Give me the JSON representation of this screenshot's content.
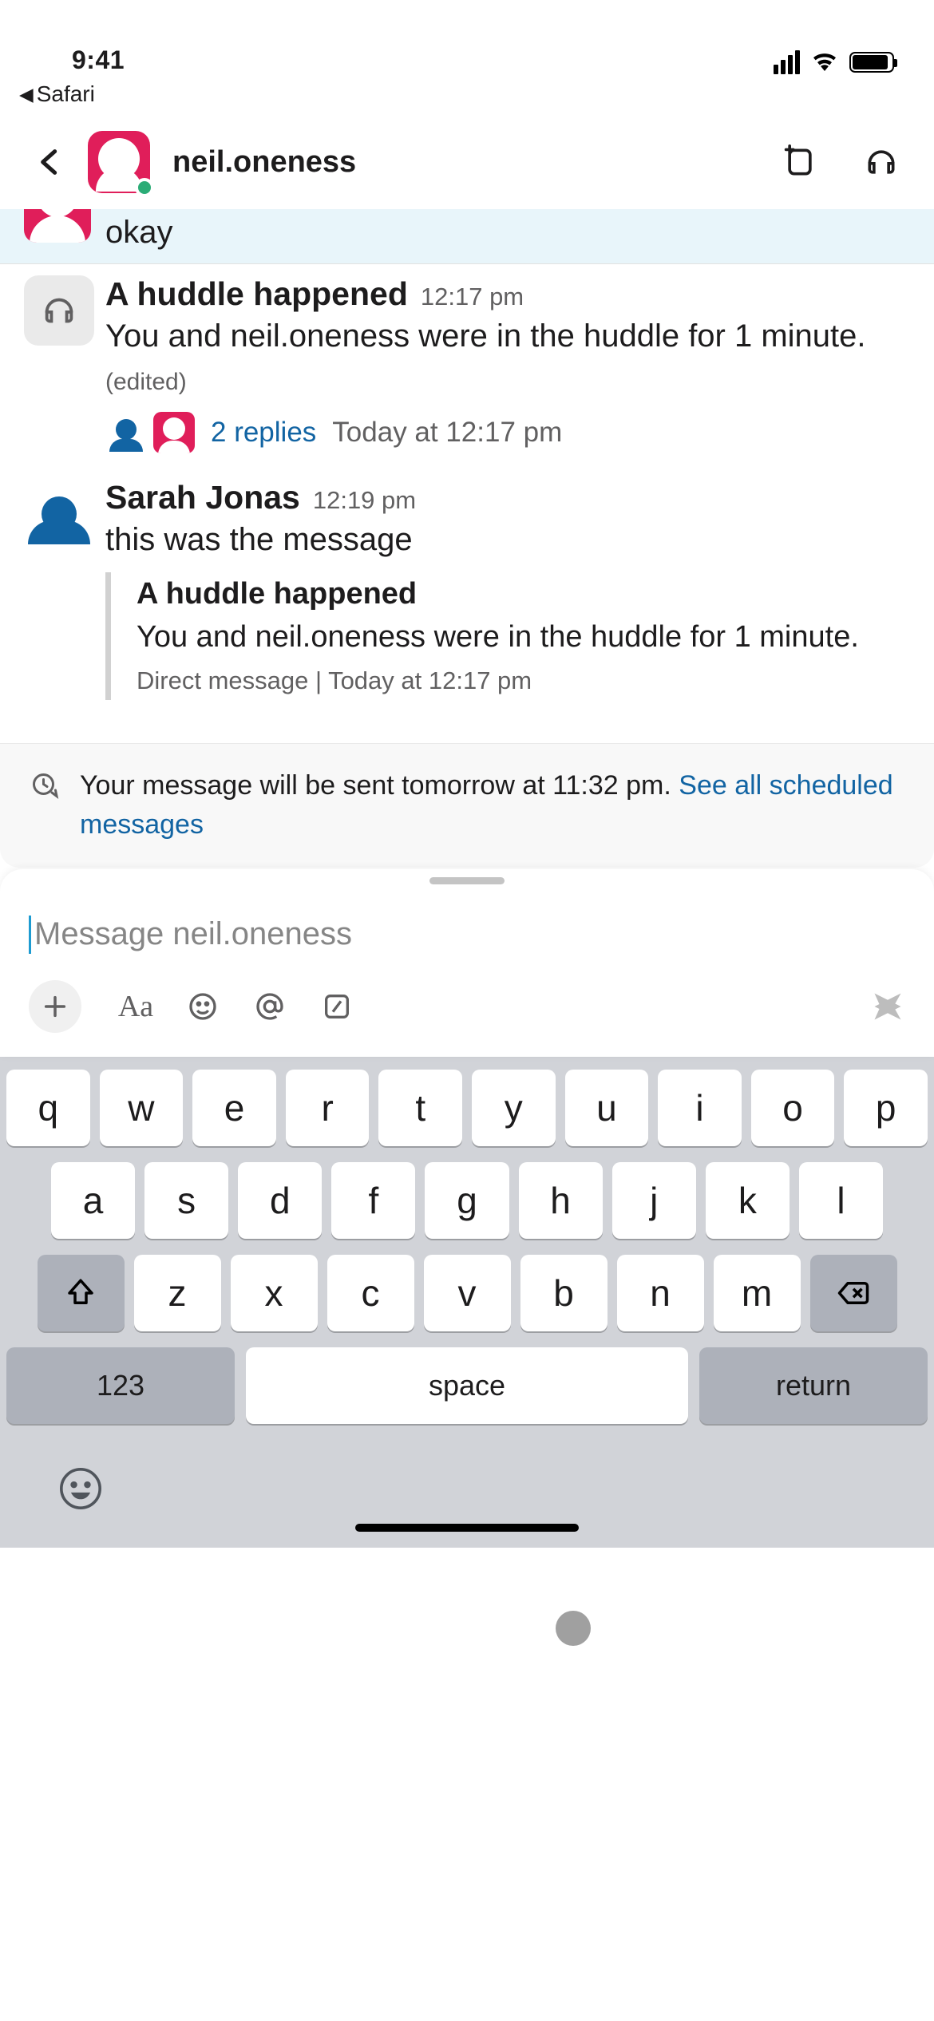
{
  "status": {
    "time": "9:41"
  },
  "back_app": "Safari",
  "header": {
    "title": "neil.oneness"
  },
  "messages": {
    "prev": {
      "text": "okay"
    },
    "huddle": {
      "title": "A huddle happened",
      "ts": "12:17 pm",
      "body_prefix": "You and neil.oneness were in the huddle for 1 minute. ",
      "edited": "(edited)",
      "replies": "2 replies",
      "replies_ts": "Today at 12:17 pm"
    },
    "sarah": {
      "sender": "Sarah Jonas",
      "ts": "12:19 pm",
      "text": "this was the message",
      "quote": {
        "title": "A huddle happened",
        "body": "You and neil.oneness were in the huddle for 1 minute.",
        "meta": "Direct message | Today at 12:17 pm"
      }
    }
  },
  "banner": {
    "prefix": "Your message will be sent tomorrow at 11:32 pm. ",
    "link": "See all scheduled messages"
  },
  "composer": {
    "placeholder": "Message neil.oneness"
  },
  "keyboard": {
    "r1": [
      "q",
      "w",
      "e",
      "r",
      "t",
      "y",
      "u",
      "i",
      "o",
      "p"
    ],
    "r2": [
      "a",
      "s",
      "d",
      "f",
      "g",
      "h",
      "j",
      "k",
      "l"
    ],
    "r3": [
      "z",
      "x",
      "c",
      "v",
      "b",
      "n",
      "m"
    ],
    "num": "123",
    "space": "space",
    "ret": "return"
  }
}
